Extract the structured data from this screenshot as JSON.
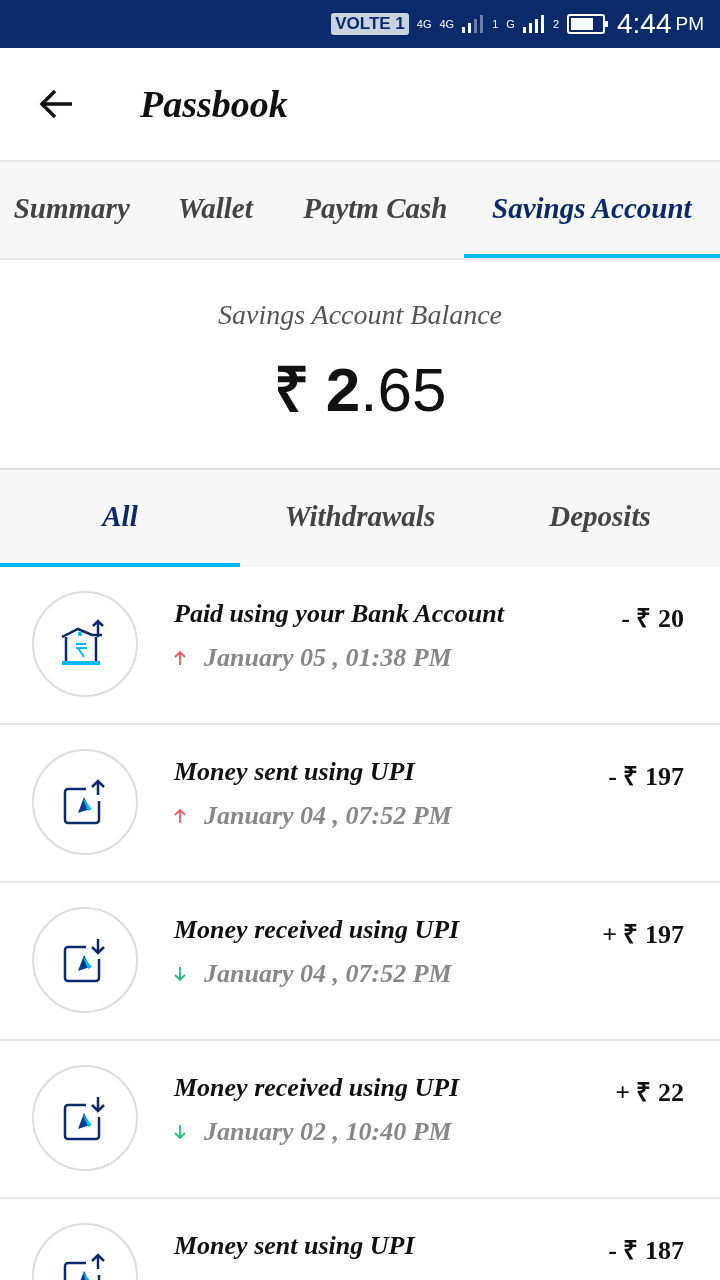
{
  "status_bar": {
    "volte": "VOLTE 1",
    "net1": "4G",
    "net1b": "4G",
    "sim1": "1",
    "net2": "G",
    "sim2": "2",
    "time": "4:44",
    "ampm": "PM"
  },
  "header": {
    "title": "Passbook"
  },
  "tabs": [
    {
      "label": "Summary",
      "selected": false
    },
    {
      "label": "Wallet",
      "selected": false
    },
    {
      "label": "Paytm Cash",
      "selected": false
    },
    {
      "label": "Savings Account",
      "selected": true
    }
  ],
  "balance": {
    "label": "Savings Account Balance",
    "amount": "**₹ 2**.65"
  },
  "filters": [
    {
      "label": "All",
      "selected": true
    },
    {
      "label": "Withdrawals",
      "selected": false
    },
    {
      "label": "Deposits",
      "selected": false
    }
  ],
  "transactions": [
    {
      "kind": "bank",
      "outgoing": true,
      "title": "Paid using your Bank Account",
      "date": "January 05 , 01:38 PM",
      "amount": "- ₹ 20"
    },
    {
      "kind": "upi",
      "outgoing": true,
      "title": "Money sent using UPI",
      "date": "January 04 , 07:52 PM",
      "amount": "- ₹ 197"
    },
    {
      "kind": "upi",
      "outgoing": false,
      "title": "Money received using UPI",
      "date": "January 04 , 07:52 PM",
      "amount": "+ ₹ 197"
    },
    {
      "kind": "upi",
      "outgoing": false,
      "title": "Money received using UPI",
      "date": "January 02 , 10:40 PM",
      "amount": "+ ₹ 22"
    },
    {
      "kind": "upi",
      "outgoing": true,
      "title": "Money sent using UPI",
      "amount": "- ₹ 187"
    }
  ]
}
